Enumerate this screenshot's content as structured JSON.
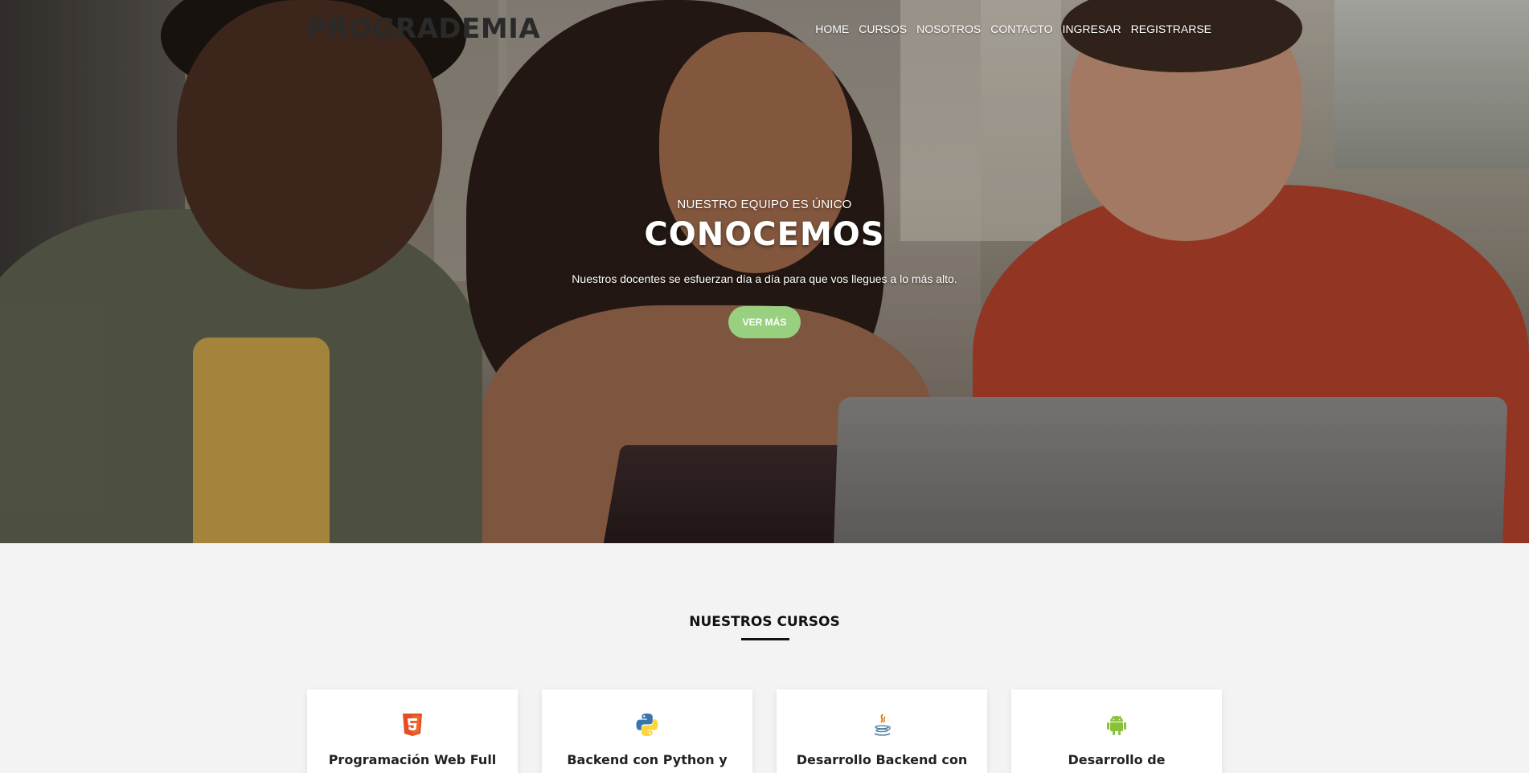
{
  "brand": {
    "logo": "PROGRADEMIA"
  },
  "nav": {
    "items": [
      {
        "label": "HOME"
      },
      {
        "label": "CURSOS"
      },
      {
        "label": "NOSOTROS"
      },
      {
        "label": "CONTACTO"
      },
      {
        "label": "INGRESAR"
      },
      {
        "label": "REGISTRARSE"
      }
    ]
  },
  "hero": {
    "eyebrow": "NUESTRO EQUIPO ES ÚNICO",
    "title": "CONOCEMOS",
    "description": "Nuestros docentes se esfuerzan día a día para que vos llegues a lo más alto.",
    "cta_label": "VER MÁS",
    "cta_color": "#98d07f"
  },
  "courses": {
    "title": "NUESTROS CURSOS",
    "cards": [
      {
        "icon": "html5-icon",
        "title": "Programación Web Full"
      },
      {
        "icon": "python-icon",
        "title": "Backend con Python y"
      },
      {
        "icon": "java-icon",
        "title": "Desarrollo Backend con"
      },
      {
        "icon": "android-icon",
        "title": "Desarrollo de"
      }
    ]
  }
}
